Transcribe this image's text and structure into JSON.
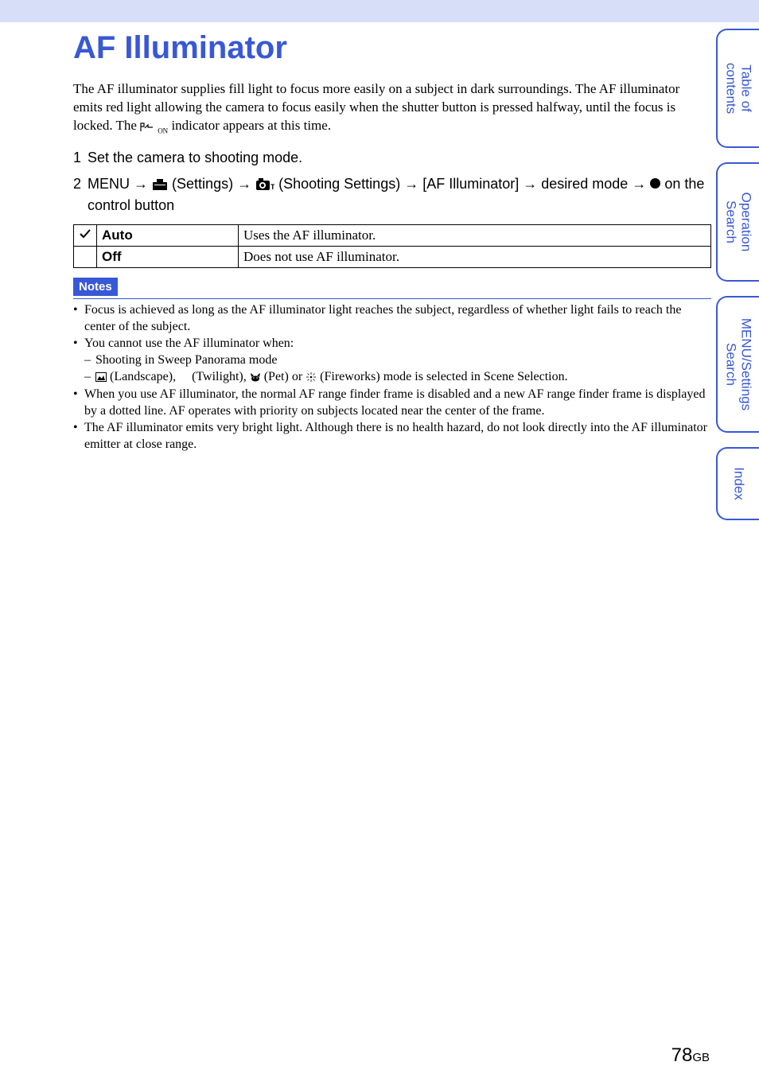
{
  "title": "AF Illuminator",
  "intro": "The AF illuminator supplies fill light to focus more easily on a subject in dark surroundings. The AF illuminator emits red light allowing the camera to focus easily when the shutter button is pressed halfway, until the focus is locked. The ",
  "intro_suffix": " indicator appears at this time.",
  "indicator_sub": "ON",
  "steps": {
    "s1": "Set the camera to shooting mode.",
    "s2_prefix": "MENU ",
    "s2_settings": " (Settings) ",
    "s2_shooting": " (Shooting Settings) ",
    "s2_af": " [AF Illuminator] ",
    "s2_desired": " desired mode ",
    "s2_button": " on the control button"
  },
  "table": {
    "rows": [
      {
        "check": true,
        "label": "Auto",
        "desc": "Uses the AF illuminator."
      },
      {
        "check": false,
        "label": "Off",
        "desc": "Does not use AF illuminator."
      }
    ]
  },
  "notes_label": "Notes",
  "notes": {
    "n1": "Focus is achieved as long as the AF illuminator light reaches the subject, regardless of whether light fails to reach the center of the subject.",
    "n2": "You cannot use the AF illuminator when:",
    "n2a": "Shooting in Sweep Panorama mode",
    "n2b_land": " (Landscape), ",
    "n2b_twi": " (Twilight), ",
    "n2b_pet": " (Pet) or ",
    "n2b_fire": " (Fireworks) mode is selected in Scene Selection.",
    "n3": "When you use AF illuminator, the normal AF range finder frame is disabled and a new AF range finder frame is displayed by a dotted line. AF operates with priority on subjects located near the center of the frame.",
    "n4": "The AF illuminator emits very bright light. Although there is no health hazard, do not look directly into the AF illuminator emitter at close range."
  },
  "tabs": {
    "toc": "Table of\ncontents",
    "op": "Operation\nSearch",
    "menu": "MENU/Settings\nSearch",
    "index": "Index"
  },
  "page_number": "78",
  "page_suffix": "GB"
}
